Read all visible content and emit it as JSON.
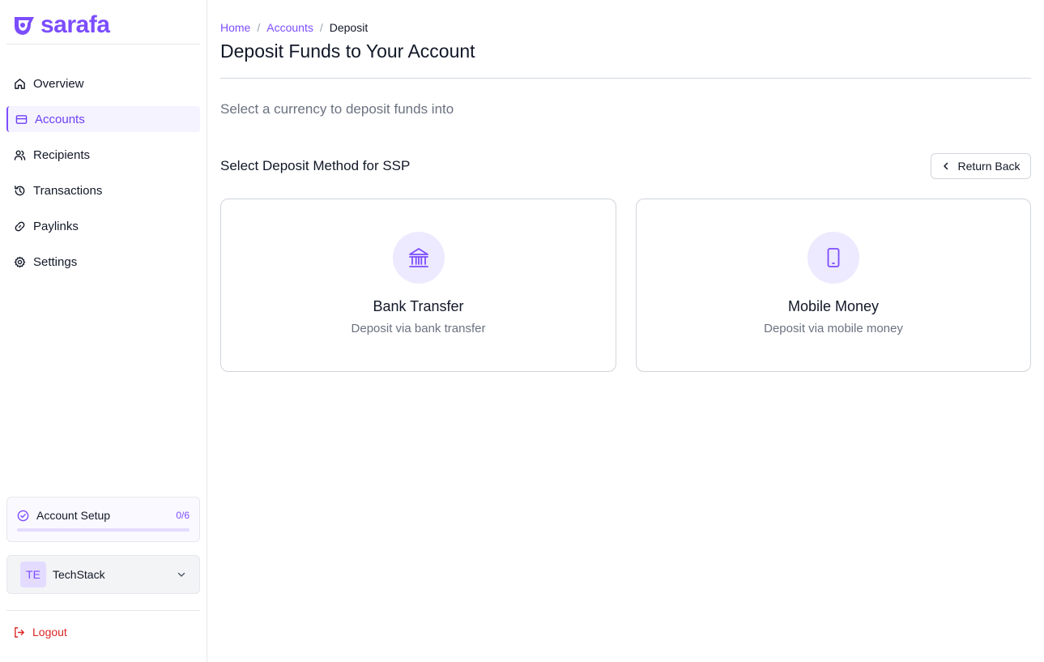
{
  "app": {
    "logo_text": "sarafa",
    "brand_color": "#7c4dff"
  },
  "sidebar": {
    "items": [
      {
        "label": "Overview",
        "icon": "home-icon"
      },
      {
        "label": "Accounts",
        "icon": "card-icon",
        "active": true
      },
      {
        "label": "Recipients",
        "icon": "users-icon"
      },
      {
        "label": "Transactions",
        "icon": "history-icon"
      },
      {
        "label": "Paylinks",
        "icon": "link-icon"
      },
      {
        "label": "Settings",
        "icon": "gear-icon"
      }
    ],
    "setup": {
      "label": "Account Setup",
      "count": "0/6",
      "progress": 0
    },
    "workspace": {
      "initials": "TE",
      "name": "TechStack"
    },
    "logout_label": "Logout"
  },
  "breadcrumb": {
    "home": "Home",
    "sep1": "/",
    "accounts": "Accounts",
    "sep2": "/",
    "current": "Deposit"
  },
  "main": {
    "title": "Deposit Funds to Your Account",
    "subtitle": "Select a currency to deposit funds into",
    "section_title": "Select Deposit Method for SSP",
    "return_label": "Return Back",
    "methods": [
      {
        "title": "Bank Transfer",
        "desc": "Deposit via bank transfer",
        "icon": "bank-icon"
      },
      {
        "title": "Mobile Money",
        "desc": "Deposit via mobile money",
        "icon": "phone-icon"
      }
    ]
  }
}
